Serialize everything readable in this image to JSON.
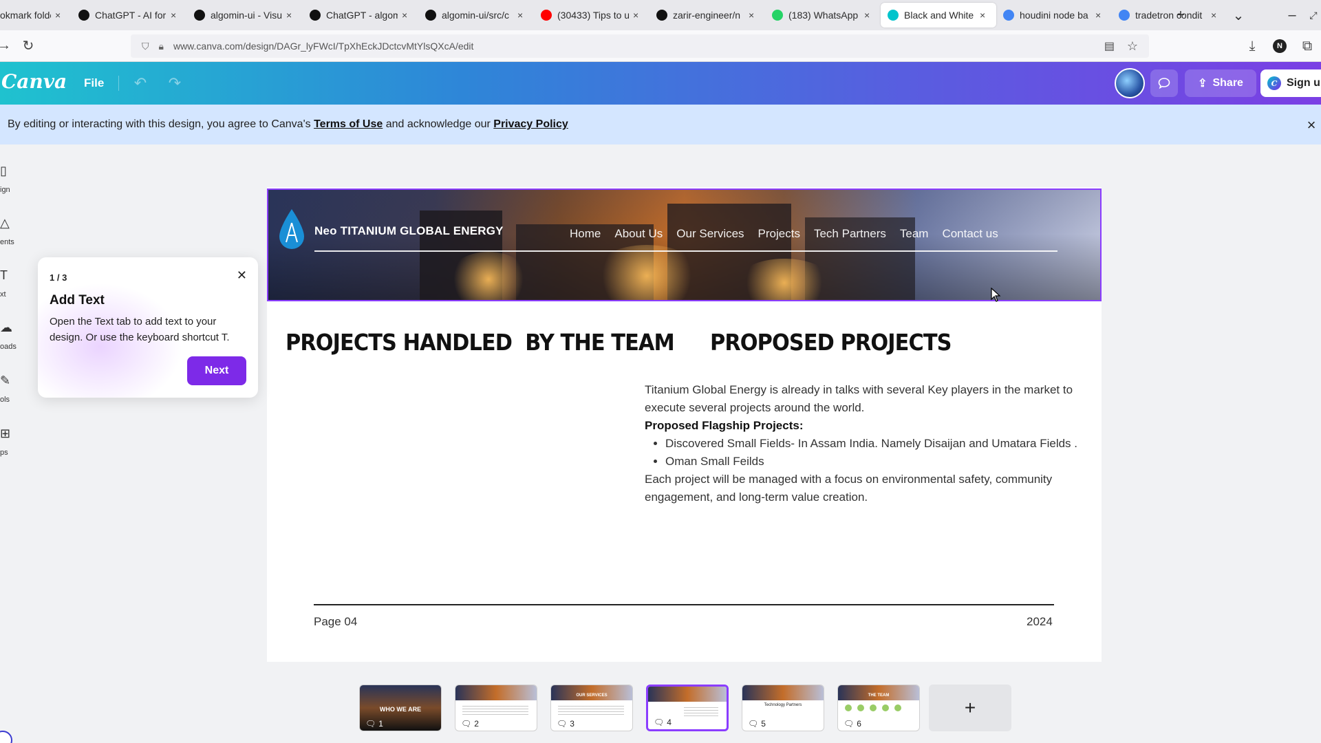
{
  "browser": {
    "tabs": [
      {
        "title": "okmark folde",
        "color": "#888888"
      },
      {
        "title": "ChatGPT - AI for",
        "color": "#111111"
      },
      {
        "title": "algomin-ui - Visu",
        "color": "#111111"
      },
      {
        "title": "ChatGPT - algom",
        "color": "#111111"
      },
      {
        "title": "algomin-ui/src/c",
        "color": "#111111"
      },
      {
        "title": "(30433) Tips to u",
        "color": "#ff0000"
      },
      {
        "title": "zarir-engineer/n",
        "color": "#111111"
      },
      {
        "title": "(183) WhatsApp",
        "color": "#25d366"
      },
      {
        "title": "Black and White",
        "color": "#00c4cc"
      },
      {
        "title": "houdini node ba",
        "color": "#4285f4"
      },
      {
        "title": "tradetron condit",
        "color": "#4285f4"
      }
    ],
    "active_tab_index": 8,
    "url": "www.canva.com/design/DAGr_lyFWcI/TpXhEckJDctcvMtYlsQXcA/edit"
  },
  "canva": {
    "logo": "Canva",
    "file_label": "File",
    "share_label": "Share",
    "signup_label": "Sign up"
  },
  "banner": {
    "prefix": "By editing or interacting with this design, you agree to Canva's ",
    "terms": "Terms of Use",
    "middle": " and acknowledge our ",
    "privacy": "Privacy Policy"
  },
  "sidebar": {
    "items": [
      {
        "label": "ign"
      },
      {
        "label": "ents"
      },
      {
        "label": "xt"
      },
      {
        "label": "oads"
      },
      {
        "label": "ols"
      },
      {
        "label": "ps"
      }
    ]
  },
  "popover": {
    "step": "1 / 3",
    "title": "Add Text",
    "body": "Open the Text tab to add text to your design. Or use the keyboard shortcut T.",
    "next_label": "Next"
  },
  "design": {
    "brand": "Neo TITANIUM GLOBAL ENERGY",
    "nav": [
      "Home",
      "About Us",
      "Our Services",
      "Projects",
      "Tech Partners",
      "Team",
      "Contact us"
    ],
    "heading_left": "PROJECTS HANDLED  BY THE TEAM",
    "heading_right": "PROPOSED PROJECTS",
    "intro": "Titanium Global Energy is already in talks with several Key players in the market to execute several projects around the world.",
    "flagship_title": "Proposed Flagship Projects:",
    "bullets": [
      "Discovered Small Fields- In Assam India. Namely Disaijan and Umatara Fields  .",
      "Oman Small Feilds"
    ],
    "closing": "Each project will be managed with a focus on environmental safety, community engagement, and long-term value creation.",
    "page_label": "Page 04",
    "year": "2024"
  },
  "thumbnails": [
    {
      "number": "1",
      "title": "WHO WE ARE"
    },
    {
      "number": "2",
      "title": ""
    },
    {
      "number": "3",
      "title": "OUR SERVICES"
    },
    {
      "number": "4",
      "title": ""
    },
    {
      "number": "5",
      "title": "Technology Partners"
    },
    {
      "number": "6",
      "title": "THE TEAM"
    }
  ],
  "selected_thumbnail": 4,
  "add_page_label": "+"
}
